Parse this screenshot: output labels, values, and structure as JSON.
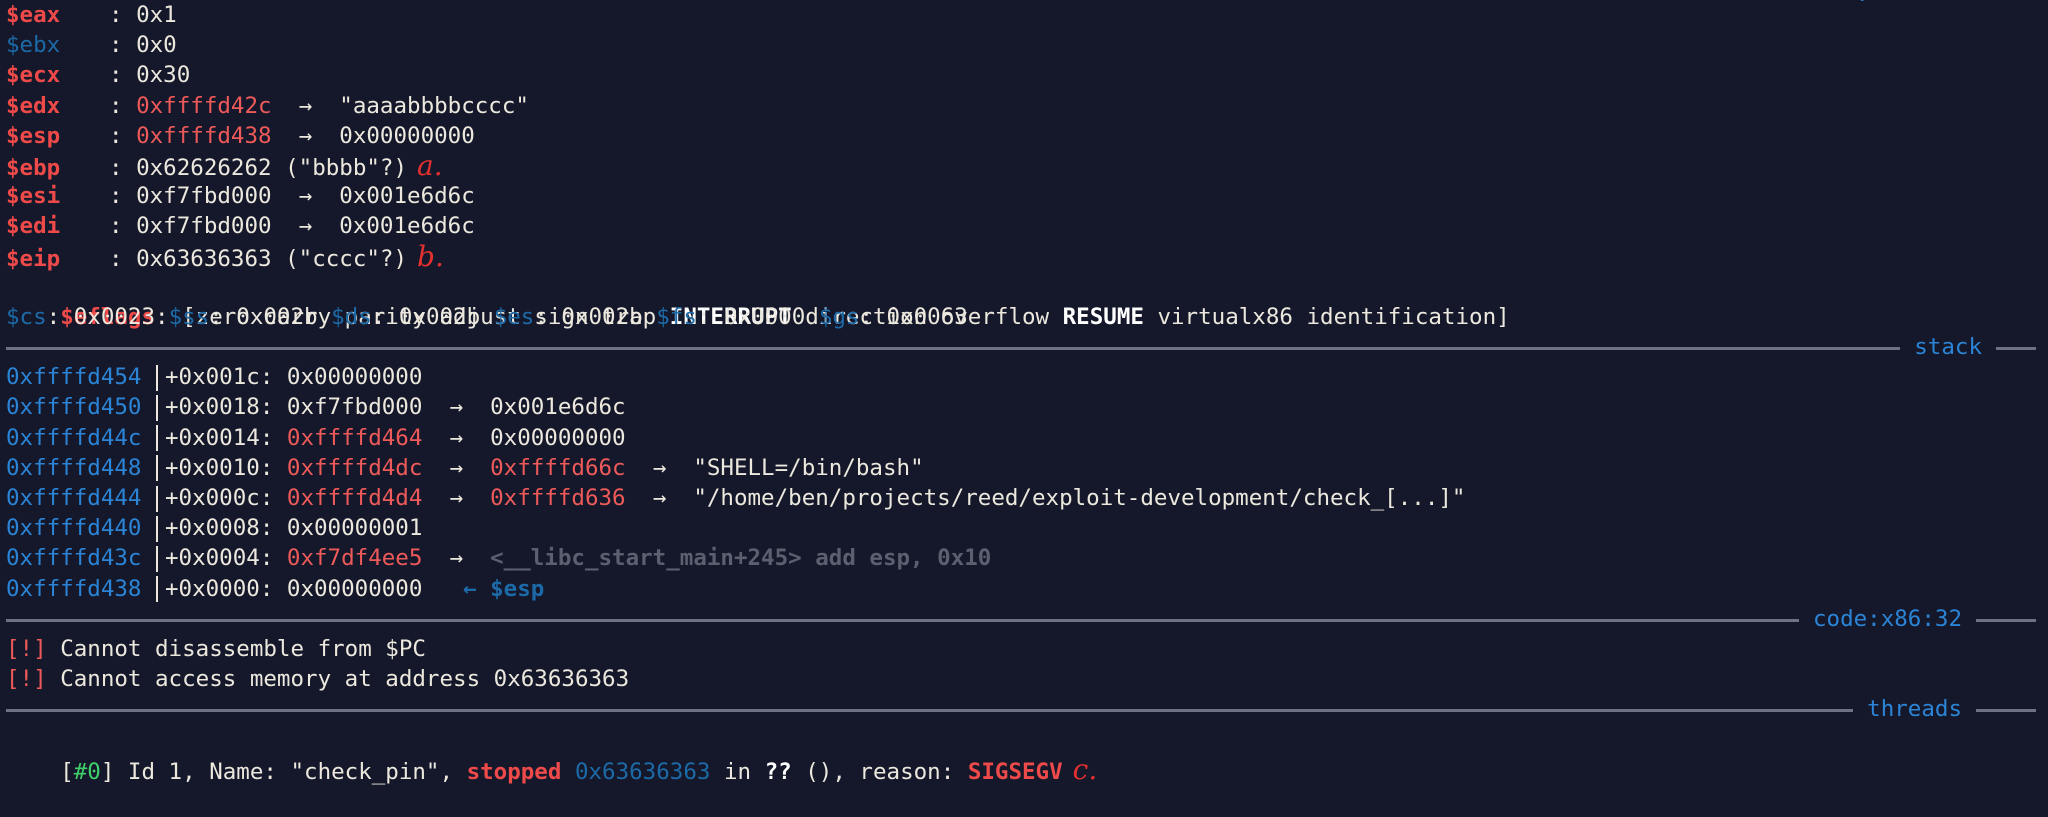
{
  "registers": [
    {
      "name": "$eax",
      "style": "red",
      "value": "0x1",
      "value_style": "plain"
    },
    {
      "name": "$ebx",
      "style": "bluemute",
      "value": "0x0",
      "value_style": "plain"
    },
    {
      "name": "$ecx",
      "style": "red",
      "value": "0x30",
      "value_style": "plain"
    },
    {
      "name": "$edx",
      "style": "red",
      "value": "0xffffd42c",
      "value_style": "redv",
      "arrow": "→",
      "deref": "\"aaaabbbbcccc\""
    },
    {
      "name": "$esp",
      "style": "red",
      "value": "0xffffd438",
      "value_style": "redv",
      "arrow": "→",
      "deref": "0x00000000"
    },
    {
      "name": "$ebp",
      "style": "red",
      "value": "0x62626262 (\"bbbb\"?)",
      "value_style": "plain",
      "annotation": "a."
    },
    {
      "name": "$esi",
      "style": "red",
      "value": "0xf7fbd000",
      "value_style": "plain",
      "arrow": "→",
      "deref": "0x001e6d6c"
    },
    {
      "name": "$edi",
      "style": "red",
      "value": "0xf7fbd000",
      "value_style": "plain",
      "arrow": "→",
      "deref": "0x001e6d6c"
    },
    {
      "name": "$eip",
      "style": "red",
      "value": "0x63636363 (\"cccc\"?)",
      "value_style": "plain",
      "annotation": "b."
    }
  ],
  "colon": ":",
  "eflags": {
    "name": "$eflags",
    "open": "[zero carry parity adjust sign trap ",
    "interrupt": "INTERRUPT",
    "mid": " direction overflow ",
    "resume": "RESUME",
    "close": " virtualx86 identification]"
  },
  "segments": [
    {
      "name": "$cs",
      "value": "0x0023"
    },
    {
      "name": "$ss",
      "value": "0x002b"
    },
    {
      "name": "$ds",
      "value": "0x002b"
    },
    {
      "name": "$es",
      "value": "0x002b"
    },
    {
      "name": "$fs",
      "value": "0x0000"
    },
    {
      "name": "$gs",
      "value": "0x0063"
    }
  ],
  "sections": {
    "stack": "stack",
    "code": "code:x86:32",
    "threads": "threads"
  },
  "stack": [
    {
      "addr": "0xffffd454",
      "off": "+0x001c:",
      "v1": "0x00000000"
    },
    {
      "addr": "0xffffd450",
      "off": "+0x0018:",
      "v1": "0xf7fbd000",
      "a1": "→",
      "v2": "0x001e6d6c"
    },
    {
      "addr": "0xffffd44c",
      "off": "+0x0014:",
      "v1": "0xffffd464",
      "v1red": true,
      "a1": "→",
      "v2": "0x00000000"
    },
    {
      "addr": "0xffffd448",
      "off": "+0x0010:",
      "v1": "0xffffd4dc",
      "v1red": true,
      "a1": "→",
      "v2": "0xffffd66c",
      "v2red": true,
      "a2": "→",
      "v3": "\"SHELL=/bin/bash\""
    },
    {
      "addr": "0xffffd444",
      "off": "+0x000c:",
      "v1": "0xffffd4d4",
      "v1red": true,
      "a1": "→",
      "v2": "0xffffd636",
      "v2red": true,
      "a2": "→",
      "v3": "\"/home/ben/projects/reed/exploit-development/check_[...]\""
    },
    {
      "addr": "0xffffd440",
      "off": "+0x0008:",
      "v1": "0x00000001"
    },
    {
      "addr": "0xffffd43c",
      "off": "+0x0004:",
      "v1": "0xf7df4ee5",
      "v1red": true,
      "a1": "→",
      "v2": "<__libc_start_main+245> add esp, 0x10",
      "v2gray": true
    },
    {
      "addr": "0xffffd438",
      "off": "+0x0000:",
      "v1": "0x00000000",
      "esp_marker": "← $esp"
    }
  ],
  "code_errors": [
    {
      "tag": "[!]",
      "text": "Cannot disassemble from $PC"
    },
    {
      "tag": "[!]",
      "text": "Cannot access memory at address 0x63636363"
    }
  ],
  "thread": {
    "open": "[",
    "id_tag": "#0",
    "close": "]",
    "text1": " Id 1, Name: \"check_pin\", ",
    "stopped": "stopped",
    "addr": "0x63636363",
    "in": " in ",
    "qq": "??",
    "text2": " (), reason: ",
    "signal": "SIGSEGV",
    "annotation": "c."
  },
  "colors": {
    "background": "#14182a",
    "red": "#ee4a4a",
    "blue": "#2b84d6",
    "text": "#ece8de",
    "green": "#3fd06a"
  }
}
